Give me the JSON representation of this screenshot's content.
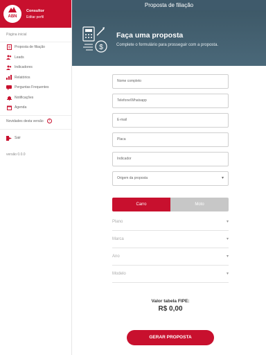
{
  "profile": {
    "logo_text": "ABN",
    "name": "Consultor",
    "edit_label": "Editar perfil"
  },
  "nav": {
    "home_label": "Página inicial",
    "items": [
      {
        "label": "Proposta de filiação",
        "icon": "document-icon"
      },
      {
        "label": "Leads",
        "icon": "people-icon"
      },
      {
        "label": "Indicadores",
        "icon": "people-icon"
      },
      {
        "label": "Relatórios",
        "icon": "chart-icon"
      },
      {
        "label": "Perguntas Frequentes",
        "icon": "chat-icon"
      },
      {
        "label": "Notificações",
        "icon": "bell-icon"
      },
      {
        "label": "Agenda",
        "icon": "calendar-icon"
      }
    ],
    "news_label": "Novidades desta versão",
    "news_badge": "!",
    "logout_label": "Sair",
    "version": "versão 0.0.0"
  },
  "header": {
    "title": "Proposta de filiação"
  },
  "hero": {
    "title": "Faça uma proposta",
    "subtitle": "Complete o formulário para prosseguir com a proposta."
  },
  "form": {
    "fields": [
      {
        "placeholder": "Nome completo"
      },
      {
        "placeholder": "Telefone/Whatsapp"
      },
      {
        "placeholder": "E-mail"
      },
      {
        "placeholder": "Placa"
      },
      {
        "placeholder": "Indicador"
      }
    ],
    "origin_placeholder": "Origem da proposta",
    "vehicle_type": {
      "car_label": "Carro",
      "moto_label": "Moto",
      "selected": "Carro"
    },
    "selects": [
      {
        "label": "Plano"
      },
      {
        "label": "Marca"
      },
      {
        "label": "Ano"
      },
      {
        "label": "Modelo"
      }
    ],
    "fipe_label": "Valor tabela FIPE:",
    "fipe_value": "R$ 0,00",
    "submit_label": "GERAR PROPOSTA"
  },
  "colors": {
    "brand": "#c8102e",
    "header_bg": "#3f5a6b"
  }
}
